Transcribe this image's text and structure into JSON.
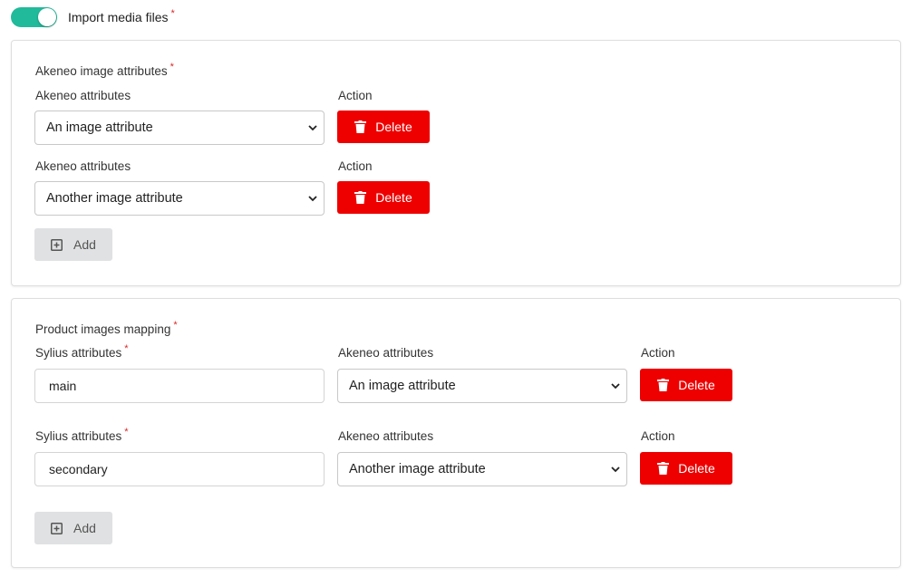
{
  "colors": {
    "toggle_on": "#21ba9b",
    "danger": "#ee0000",
    "required": "#db2828"
  },
  "header": {
    "toggle_label": "Import media files",
    "toggle_on": true,
    "required_mark": "*"
  },
  "image_attributes": {
    "title": "Akeneo image attributes",
    "rows": [
      {
        "attr_label": "Akeneo attributes",
        "value": "An image attribute",
        "action_label": "Action",
        "delete_label": "Delete"
      },
      {
        "attr_label": "Akeneo attributes",
        "value": "Another image attribute",
        "action_label": "Action",
        "delete_label": "Delete"
      }
    ],
    "add_label": "Add"
  },
  "product_images": {
    "title": "Product images mapping",
    "rows": [
      {
        "sylius_label": "Sylius attributes",
        "sylius_value": "main",
        "akeneo_label": "Akeneo attributes",
        "akeneo_value": "An image attribute",
        "action_label": "Action",
        "delete_label": "Delete"
      },
      {
        "sylius_label": "Sylius attributes",
        "sylius_value": "secondary",
        "akeneo_label": "Akeneo attributes",
        "akeneo_value": "Another image attribute",
        "action_label": "Action",
        "delete_label": "Delete"
      }
    ],
    "add_label": "Add"
  },
  "icons": {
    "delete": "trash-icon",
    "add": "plus-square-icon",
    "select": "chevron-down-icon"
  }
}
